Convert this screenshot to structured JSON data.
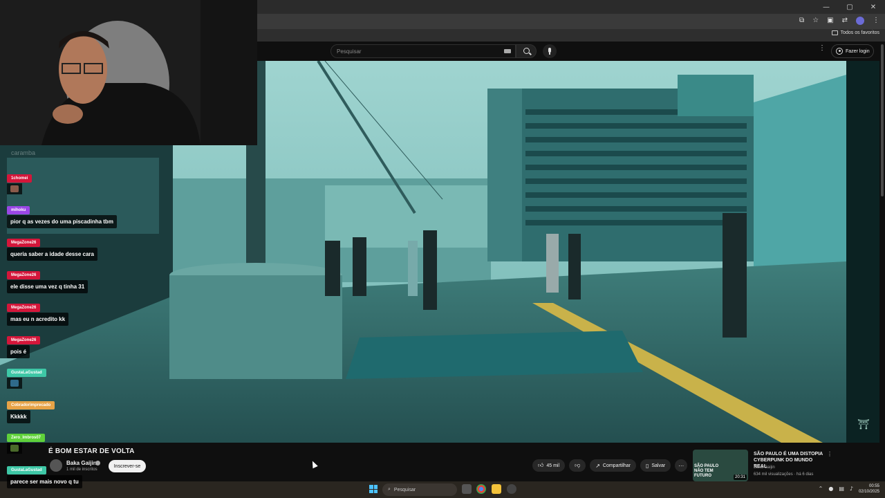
{
  "browser": {
    "bookmarks_label": "Todos os favoritos"
  },
  "youtube": {
    "search_placeholder": "Pesquisar",
    "login_label": "Fazer login",
    "video_title": "É BOM ESTAR DE VOLTA",
    "channel_name": "Baka Gaijin",
    "channel_subs": "1 mil de inscritos",
    "subscribe_label": "Inscrever-se",
    "likes": "45 mil",
    "share_label": "Compartilhar",
    "save_label": "Salvar",
    "recommended": {
      "title": "SÃO PAULO É UMA DISTOPIA CYBERPUNK DO MUNDO REAL",
      "channel": "Baka Gaijin",
      "stats": "634 mil visualizações · há 6 dias",
      "duration": "20:31",
      "thumb_text": "SÃO PAULO NÃO TEM FUTURO"
    }
  },
  "chat": {
    "ghost_text": "caramba",
    "messages": [
      {
        "user": "1chomei",
        "user_color": "#d4163a",
        "text": "",
        "emote": "#8a5a4a"
      },
      {
        "user": "mihoku",
        "user_color": "#9a47e6",
        "text": "pior q as vezes do uma piscadinha tbm",
        "emote": ""
      },
      {
        "user": "MegaZone26",
        "user_color": "#d4163a",
        "text": "queria saber a idade desse cara",
        "emote": ""
      },
      {
        "user": "MegaZone26",
        "user_color": "#d4163a",
        "text": "ele disse uma vez q tinha 31",
        "emote": ""
      },
      {
        "user": "MegaZone26",
        "user_color": "#d4163a",
        "text": "mas eu n acredito kk",
        "emote": ""
      },
      {
        "user": "MegaZone26",
        "user_color": "#d4163a",
        "text": "pois é",
        "emote": ""
      },
      {
        "user": "GustaLaGustad",
        "user_color": "#3ec7a6",
        "text": "",
        "emote": "#2f6a8a"
      },
      {
        "user": "Cobradorimprecado",
        "user_color": "#e6a347",
        "text": "Kkkkk",
        "emote": ""
      },
      {
        "user": "Zero_Imbros07",
        "user_color": "#5fd13a",
        "text": "",
        "emote": "#4a6a2a"
      },
      {
        "user": "GustaLaGustad",
        "user_color": "#3ec7a6",
        "text": "parece ser mais novo q tu",
        "emote": ""
      }
    ]
  },
  "taskbar": {
    "search_label": "Pesquisar",
    "time": "00:55",
    "date": "02/10/2025"
  }
}
